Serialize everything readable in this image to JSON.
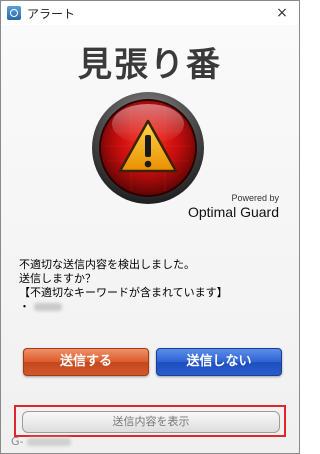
{
  "window": {
    "title": "アラート",
    "close_icon": "×"
  },
  "header": {
    "app_name": "見張り番"
  },
  "branding": {
    "powered_by": "Powered by",
    "product": "Optimal Guard"
  },
  "message": {
    "line1": "不適切な送信内容を検出しました。",
    "line2": "送信しますか？",
    "line3": "【不適切なキーワードが含まれています】",
    "line4_prefix": "・"
  },
  "buttons": {
    "send_label": "送信する",
    "cancel_label": "送信しない",
    "show_content_label": "送信内容を表示"
  },
  "footer": {
    "code_prefix": "G-"
  },
  "colors": {
    "send_button": "#d85a2a",
    "cancel_button": "#2d5fcf",
    "highlight": "#e0262a",
    "alert_red": "#b50d0d",
    "warning_yellow": "#f2a200"
  },
  "icons": {
    "alert": "warning-triangle-icon",
    "app": "app-icon"
  }
}
